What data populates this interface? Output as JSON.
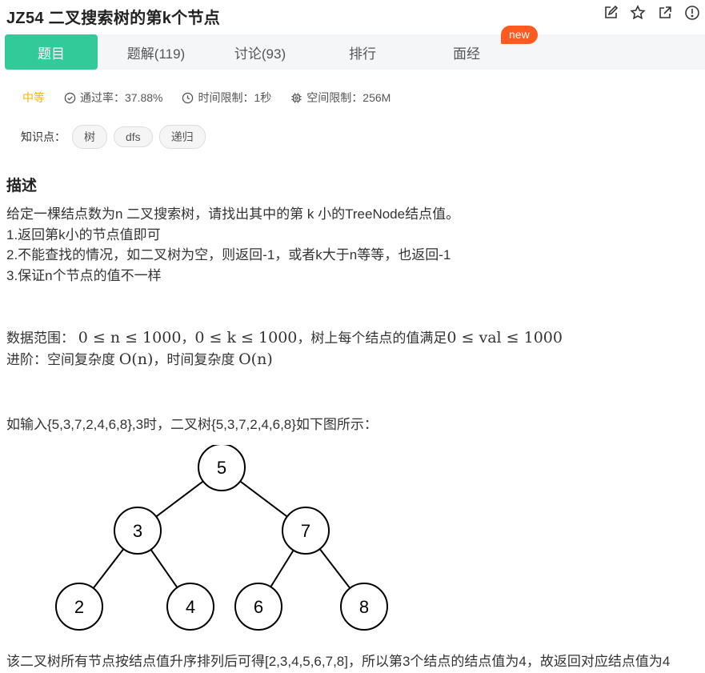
{
  "problem": {
    "title": "JZ54  二叉搜索树的第k个节点"
  },
  "tabs": [
    {
      "label": "题目"
    },
    {
      "label": "题解(119)"
    },
    {
      "label": "讨论(93)"
    },
    {
      "label": "排行"
    },
    {
      "label": "面经"
    }
  ],
  "new_badge": "new",
  "meta": {
    "difficulty": "中等",
    "pass_rate": "通过率：37.88%",
    "time_limit": "时间限制：1秒",
    "space_limit": "空间限制：256M"
  },
  "knowledge": {
    "label": "知识点：",
    "tags": [
      "树",
      "dfs",
      "递归"
    ]
  },
  "description": {
    "heading": "描述",
    "lines": [
      "给定一棵结点数为n 二叉搜索树，请找出其中的第 k 小的TreeNode结点值。",
      "1.返回第k小的节点值即可",
      "2.不能查找的情况，如二叉树为空，则返回-1，或者k大于n等等，也返回-1",
      "3.保证n个节点的值不一样"
    ],
    "range_prefix": "数据范围：",
    "range_math1": "0 ≤ n ≤ 1000",
    "range_math2": "0 ≤ k ≤ 1000",
    "range_mid": "树上每个结点的值满足",
    "range_math3": "0 ≤ val ≤ 1000",
    "advanced_prefix": "进阶：空间复杂度 ",
    "advanced_math1": "O(n)",
    "advanced_mid": "，时间复杂度 ",
    "advanced_math2": "O(n)",
    "example": "如输入{5,3,7,2,4,6,8},3时，二叉树{5,3,7,2,4,6,8}如下图所示：",
    "conclusion": "该二叉树所有节点按结点值升序排列后可得[2,3,4,5,6,7,8]，所以第3个结点的结点值为4，故返回对应结点值为4"
  },
  "tree": {
    "nodes": [
      {
        "id": "5",
        "label": "5",
        "depth": 0,
        "order": 0
      },
      {
        "id": "3",
        "label": "3",
        "depth": 1,
        "order": 0
      },
      {
        "id": "7",
        "label": "7",
        "depth": 1,
        "order": 1
      },
      {
        "id": "2",
        "label": "2",
        "depth": 2,
        "order": 0
      },
      {
        "id": "4",
        "label": "4",
        "depth": 2,
        "order": 1
      },
      {
        "id": "6",
        "label": "6",
        "depth": 2,
        "order": 2
      },
      {
        "id": "8",
        "label": "8",
        "depth": 2,
        "order": 3
      }
    ],
    "edges": [
      [
        "5",
        "3"
      ],
      [
        "5",
        "7"
      ],
      [
        "3",
        "2"
      ],
      [
        "3",
        "4"
      ],
      [
        "7",
        "6"
      ],
      [
        "7",
        "8"
      ]
    ]
  }
}
